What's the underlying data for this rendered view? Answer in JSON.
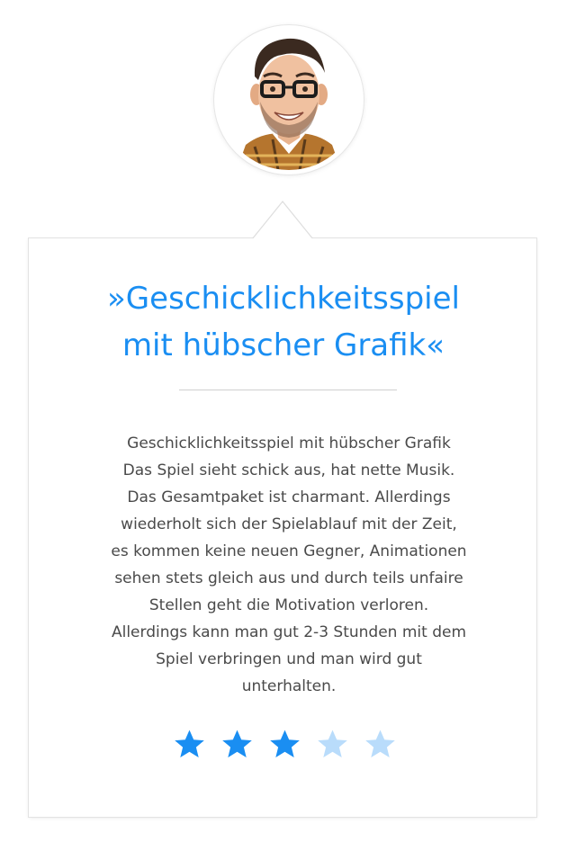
{
  "review": {
    "title_lines": [
      "»Geschicklichkeitsspiel",
      "mit hübscher Grafik«"
    ],
    "body_lines": [
      "Geschicklichkeitsspiel mit hübscher Grafik",
      "Das Spiel sieht schick aus, hat nette Musik.",
      "Das Gesamtpaket ist charmant. Allerdings",
      "wiederholt sich der Spielablauf mit der Zeit,",
      "es kommen keine neuen Gegner, Animationen",
      "sehen stets gleich aus und durch teils unfaire",
      "Stellen geht die Motivation verloren.",
      "Allerdings kann man gut 2-3 Stunden mit dem",
      "Spiel verbringen und man wird gut",
      "unterhalten."
    ],
    "rating": 3,
    "rating_max": 5
  },
  "colors": {
    "accent": "#1a8ef2",
    "star_filled": "#1a8ef2",
    "star_empty": "#b9dcfb",
    "text": "#4a4a4a",
    "divider": "#cfcfcf"
  },
  "icons": {
    "star": "star-icon",
    "avatar": "reviewer-avatar"
  }
}
